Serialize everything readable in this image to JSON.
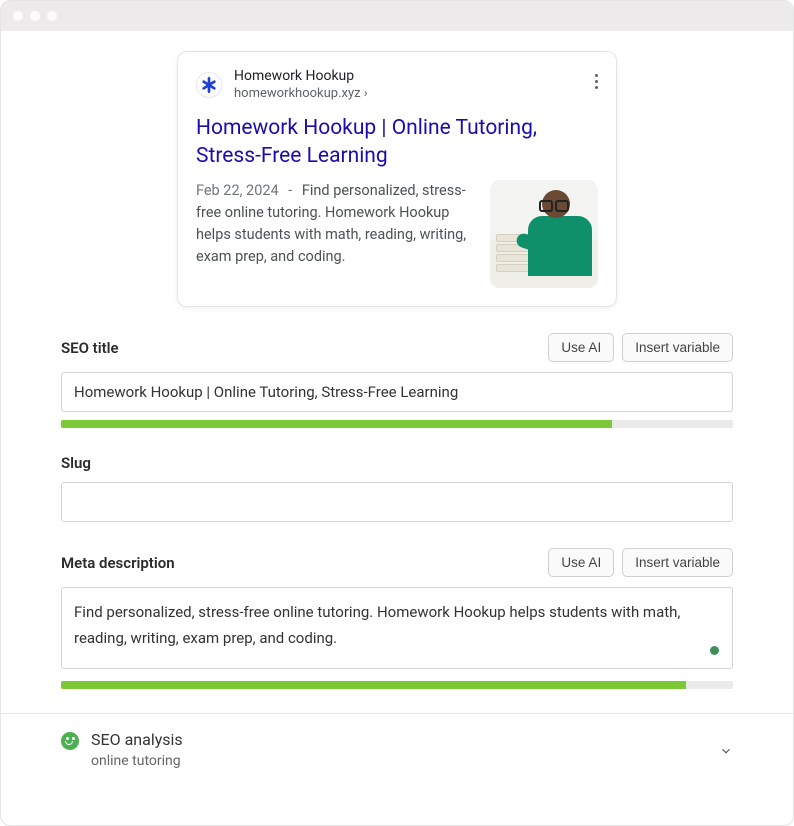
{
  "serp": {
    "site_name": "Homework Hookup",
    "site_url": "homeworkhookup.xyz ›",
    "title": "Homework Hookup | Online Tutoring, Stress-Free Learning",
    "date": "Feb 22, 2024",
    "dash": "-",
    "description": "Find personalized, stress-free online tutoring. Homework Hookup helps students with math, reading, writing, exam prep, and coding."
  },
  "fields": {
    "seo_title": {
      "label": "SEO title",
      "value": "Homework Hookup | Online Tutoring, Stress-Free Learning",
      "progress_pct": 82,
      "use_ai": "Use AI",
      "insert_var": "Insert variable"
    },
    "slug": {
      "label": "Slug",
      "value": ""
    },
    "meta_description": {
      "label": "Meta description",
      "value": "Find personalized, stress-free online tutoring. Homework Hookup helps students with math, reading, writing, exam prep, and coding.",
      "progress_pct": 93,
      "use_ai": "Use AI",
      "insert_var": "Insert variable"
    }
  },
  "analysis": {
    "title": "SEO analysis",
    "keyword": "online tutoring"
  },
  "colors": {
    "link": "#1a0dab",
    "progress": "#7bc935",
    "good": "#4caf50"
  }
}
